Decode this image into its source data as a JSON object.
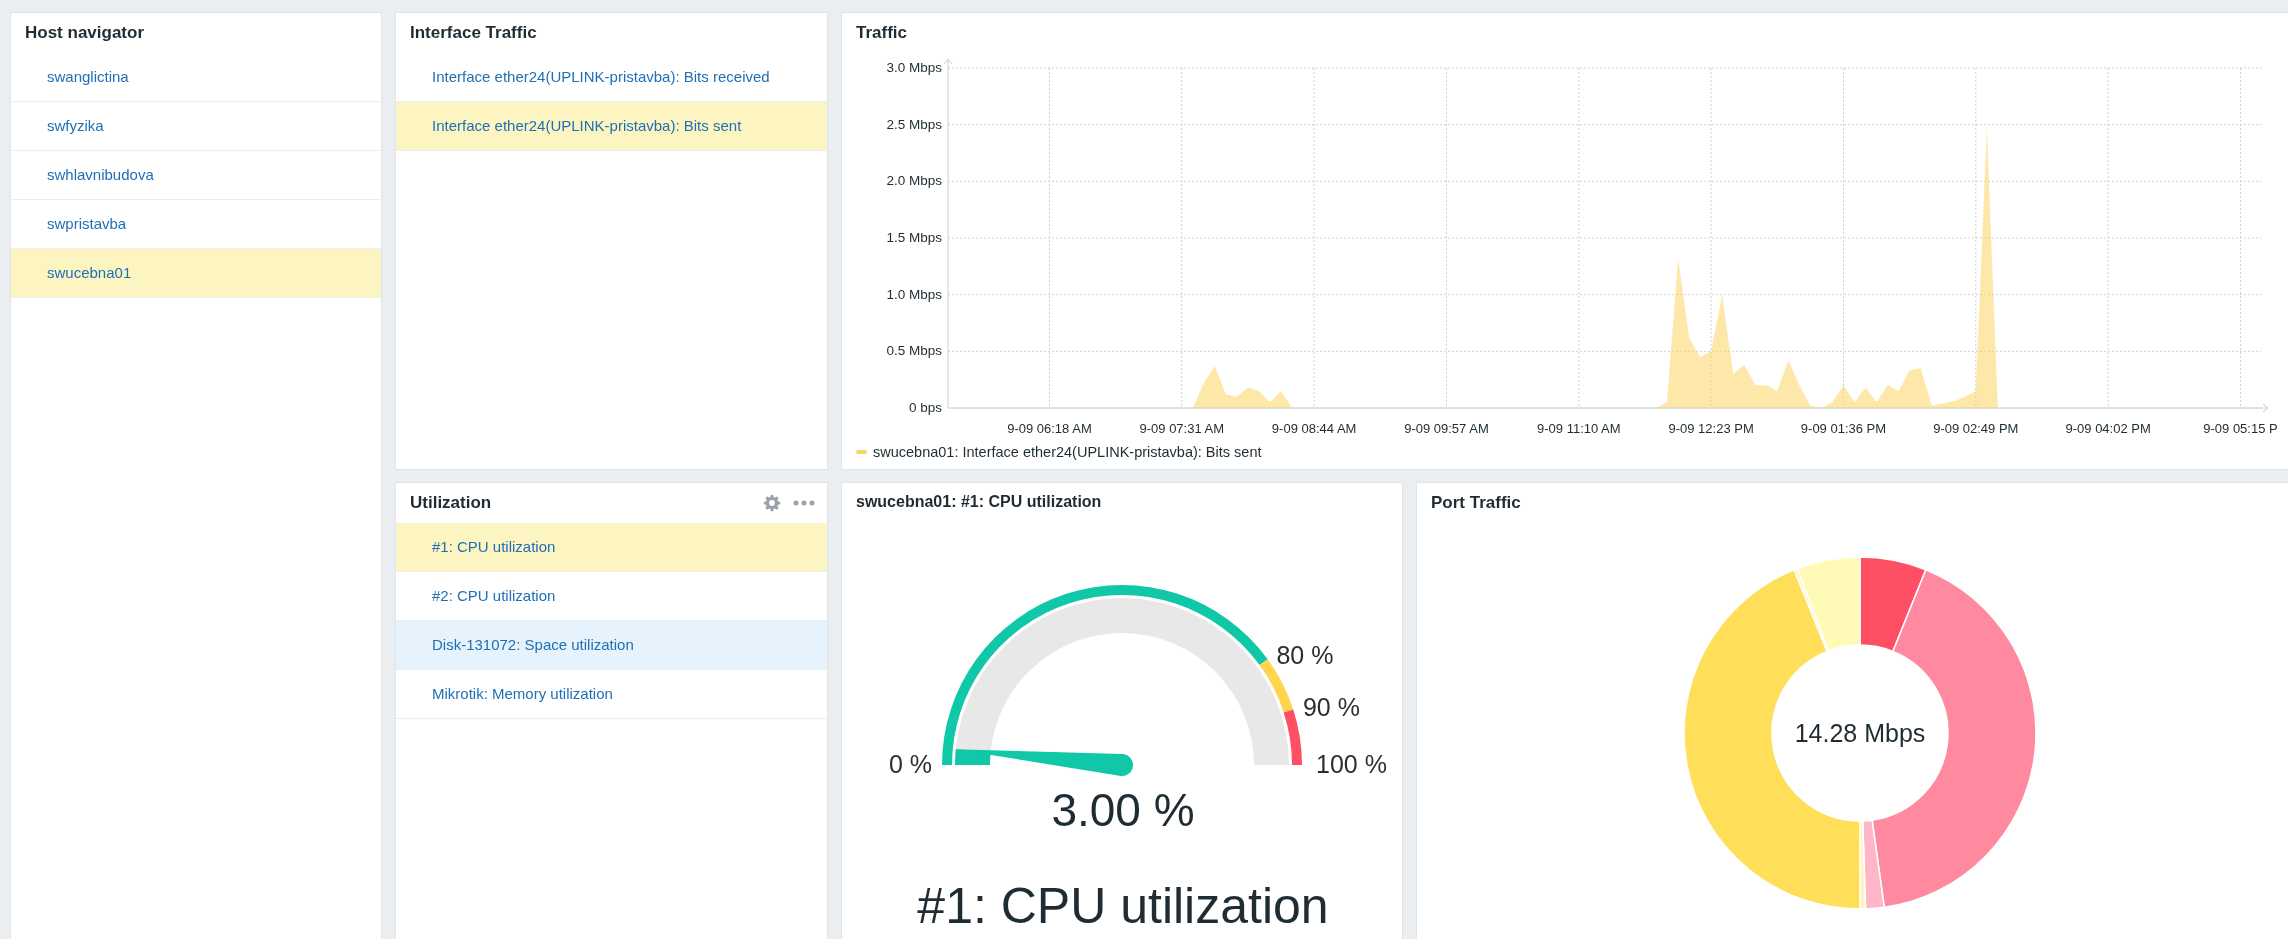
{
  "host_navigator": {
    "title": "Host navigator",
    "items": [
      {
        "label": "swanglictina",
        "selected": false
      },
      {
        "label": "swfyzika",
        "selected": false
      },
      {
        "label": "swhlavnibudova",
        "selected": false
      },
      {
        "label": "swpristavba",
        "selected": false
      },
      {
        "label": "swucebna01",
        "selected": true
      }
    ]
  },
  "interface_traffic": {
    "title": "Interface Traffic",
    "items": [
      {
        "label": "Interface ether24(UPLINK-pristavba): Bits received",
        "selected": false
      },
      {
        "label": "Interface ether24(UPLINK-pristavba): Bits sent",
        "selected": true
      }
    ]
  },
  "traffic": {
    "title": "Traffic",
    "chart_data": {
      "type": "area",
      "grid": true,
      "ylim": [
        0,
        3
      ],
      "categories": [
        null,
        null,
        null,
        null,
        null,
        null,
        null,
        null,
        null,
        "9-09 06:18 AM",
        null,
        null,
        null,
        null,
        null,
        null,
        null,
        null,
        null,
        null,
        null,
        "9-09 07:31 AM",
        null,
        null,
        null,
        null,
        null,
        null,
        null,
        null,
        null,
        null,
        null,
        "9-09 08:44 AM",
        null,
        null,
        null,
        null,
        null,
        null,
        null,
        null,
        null,
        null,
        null,
        "9-09 09:57 AM",
        null,
        null,
        null,
        null,
        null,
        null,
        null,
        null,
        null,
        null,
        null,
        "9-09 11:10 AM",
        null,
        null,
        null,
        null,
        null,
        null,
        null,
        null,
        null,
        null,
        null,
        "9-09 12:23 PM",
        null,
        null,
        null,
        null,
        null,
        null,
        null,
        null,
        null,
        null,
        null,
        "9-09 01:36 PM",
        null,
        null,
        null,
        null,
        null,
        null,
        null,
        null,
        null,
        null,
        null,
        "9-09 02:49 PM",
        null,
        null,
        null,
        null,
        null,
        null,
        null,
        null,
        null,
        null,
        null,
        "9-09 04:02 PM",
        null,
        null,
        null,
        null,
        null,
        null,
        null,
        null,
        null,
        null,
        null,
        "9-09 05:15 P"
      ],
      "series": [
        {
          "name": "swucebna01: Interface ether24(UPLINK-pristavba): Bits sent",
          "color": "#fcd665",
          "values": [
            0,
            0,
            0,
            0,
            0,
            0,
            0,
            0,
            0,
            0,
            0,
            0,
            0,
            0,
            0,
            0,
            0,
            0,
            0,
            0,
            0,
            0,
            0,
            0.22,
            0.37,
            0.12,
            0.1,
            0.18,
            0.15,
            0.05,
            0.15,
            0,
            0,
            0,
            0,
            0,
            0,
            0,
            0,
            0,
            0,
            0,
            0,
            0,
            0,
            0,
            0,
            0,
            0,
            0,
            0,
            0,
            0,
            0,
            0,
            0,
            0,
            0,
            0,
            0,
            0,
            0,
            0,
            0,
            0,
            0.05,
            1.32,
            0.62,
            0.45,
            0.5,
            1.0,
            0.3,
            0.38,
            0.2,
            0.2,
            0.15,
            0.42,
            0.2,
            0.02,
            0,
            0.05,
            0.2,
            0.05,
            0.18,
            0.05,
            0.2,
            0.15,
            0.33,
            0.35,
            0.02,
            0.04,
            0.06,
            0.1,
            0.15,
            2.47,
            0,
            0,
            0,
            0,
            0,
            0,
            0,
            0,
            0,
            0,
            0,
            0,
            0,
            0,
            0,
            0,
            0,
            0,
            0,
            0,
            0,
            0,
            0
          ]
        }
      ],
      "yticks": [
        {
          "value": 0,
          "label": "0 bps"
        },
        {
          "value": 0.5,
          "label": "0.5 Mbps"
        },
        {
          "value": 1,
          "label": "1.0 Mbps"
        },
        {
          "value": 1.5,
          "label": "1.5 Mbps"
        },
        {
          "value": 2,
          "label": "2.0 Mbps"
        },
        {
          "value": 2.5,
          "label": "2.5 Mbps"
        },
        {
          "value": 3,
          "label": "3.0 Mbps"
        }
      ]
    }
  },
  "utilization": {
    "title": "Utilization",
    "items": [
      {
        "label": "#1: CPU utilization",
        "selected": true,
        "hovered": false
      },
      {
        "label": "#2: CPU utilization",
        "selected": false,
        "hovered": false
      },
      {
        "label": "Disk-131072: Space utilization",
        "selected": false,
        "hovered": true
      },
      {
        "label": "Mikrotik: Memory utilization",
        "selected": false,
        "hovered": false
      }
    ]
  },
  "gauge": {
    "title": "swucebna01: #1: CPU utilization",
    "min_label": "0 %",
    "threshold_labels": [
      "80 %",
      "90 %"
    ],
    "max_label": "100 %",
    "value": "3.00 %",
    "description": "#1: CPU utilization"
  },
  "port_traffic": {
    "title": "Port Traffic",
    "total": "14.28 Mbps"
  }
}
